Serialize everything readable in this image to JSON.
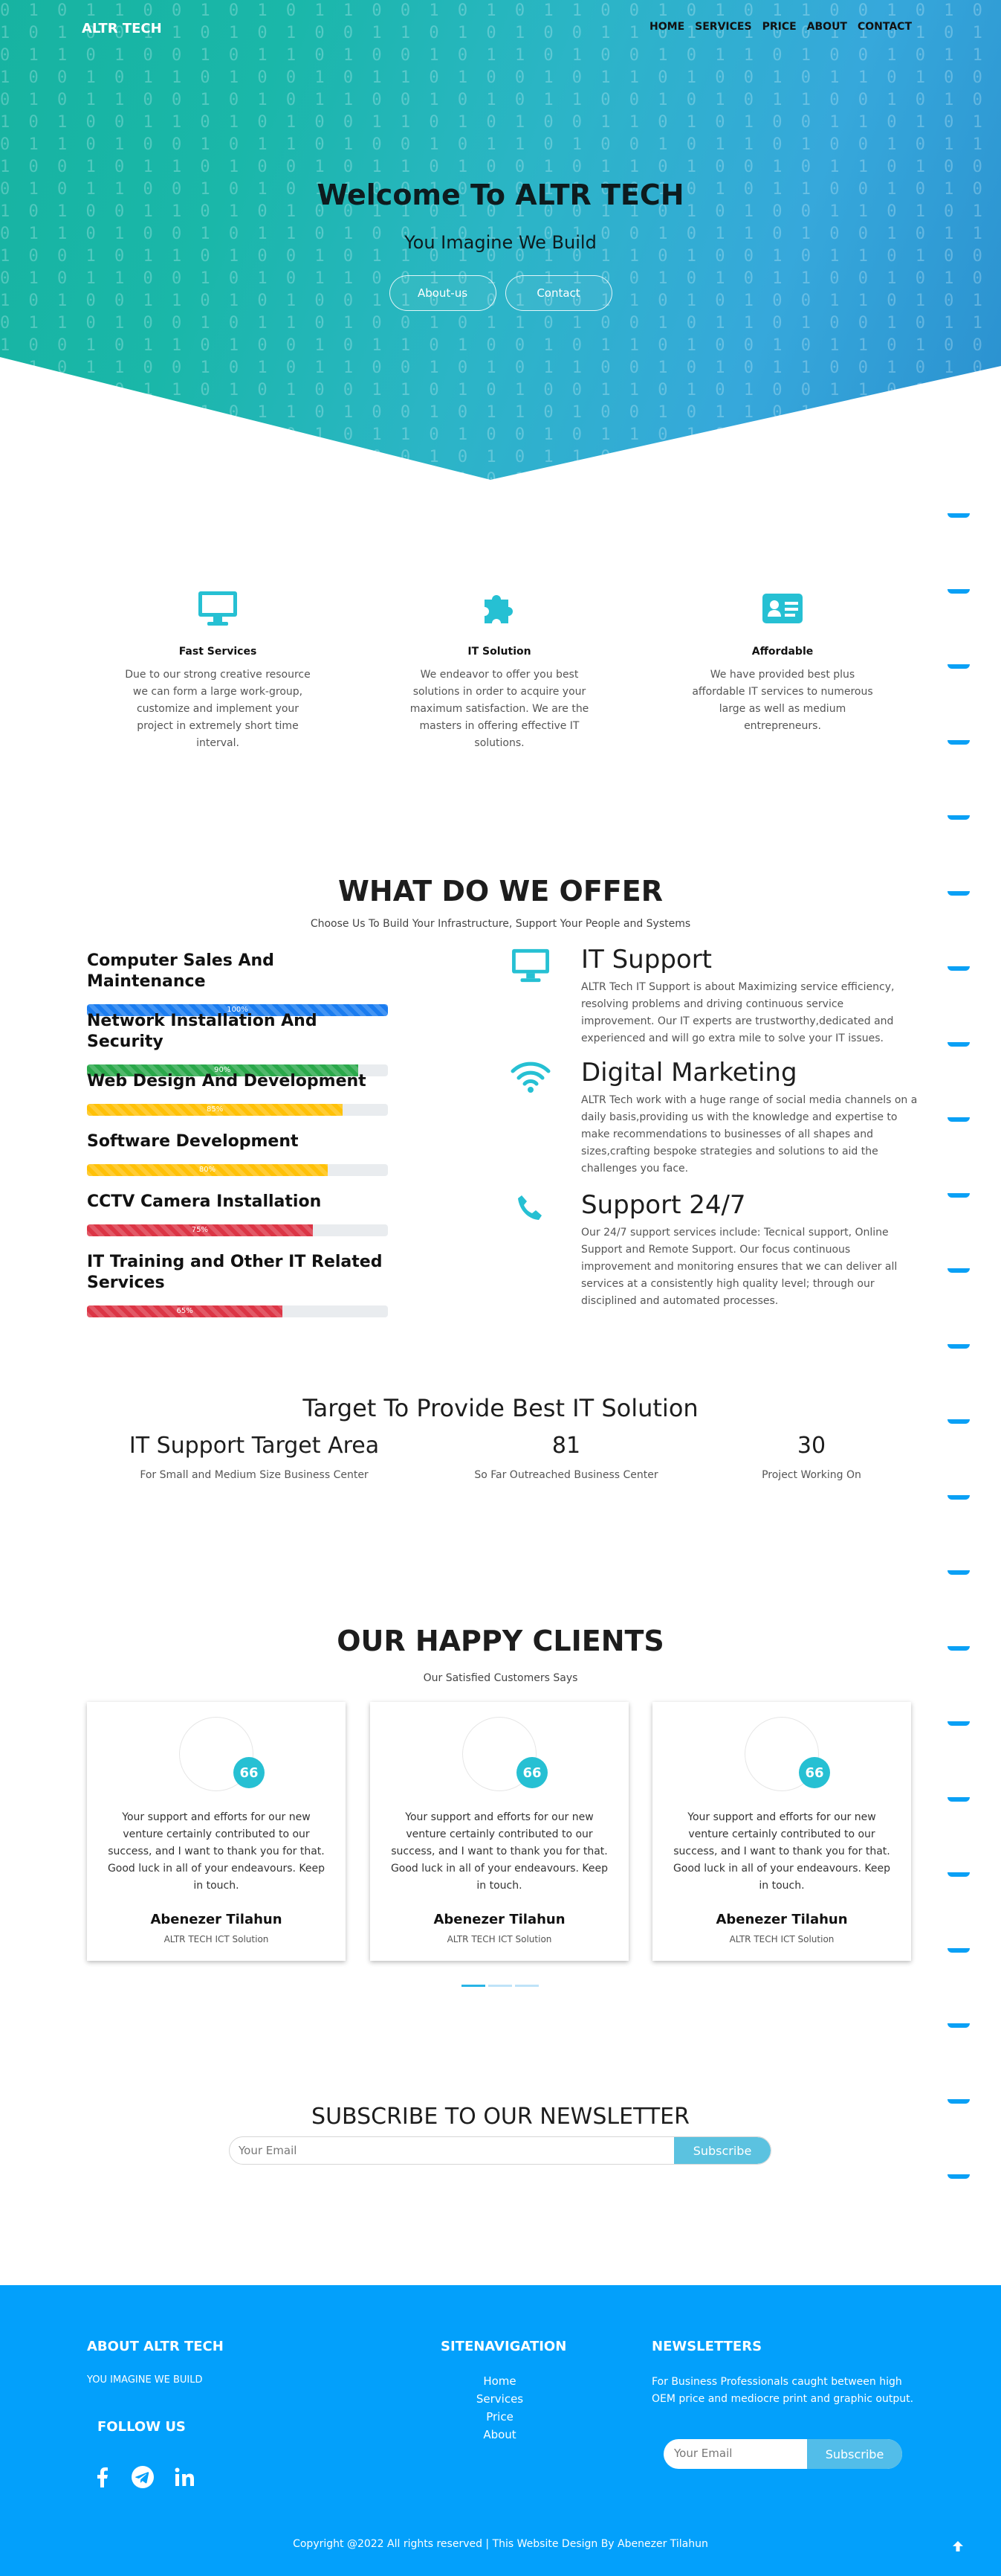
{
  "header": {
    "brand": "ALTR TECH",
    "nav": [
      "HOME",
      "SERVICES",
      "PRICE",
      "ABOUT",
      "CONTACT"
    ]
  },
  "hero": {
    "title": "Welcome To ALTR TECH",
    "subtitle": "You Imagine We Build",
    "buttons": [
      "About-us",
      "Contact"
    ]
  },
  "features": [
    {
      "icon": "monitor-icon",
      "title": "Fast  Services",
      "text": "Due to our strong creative resource we can form a large work-group, customize and implement your project in extremely short time interval."
    },
    {
      "icon": "puzzle-icon",
      "title": "IT Solution",
      "text": "We endeavor to offer you best solutions in order to acquire your maximum satisfaction. We are the masters in offering effective IT solutions."
    },
    {
      "icon": "id-card-icon",
      "title": "Affordable",
      "text": "We have provided best plus affordable IT services to numerous large as well as medium entrepreneurs."
    }
  ],
  "offer": {
    "title": "WHAT DO WE OFFER",
    "subtitle": "Choose Us To Build Your Infrastructure, Support Your People and Systems",
    "skills": [
      {
        "name": "Computer Sales And Maintenance",
        "percent": 100,
        "label": "100%",
        "color": "#1a7cf0"
      },
      {
        "name": "Network Installation And Security",
        "percent": 90,
        "label": "90%",
        "color": "#2aa84a"
      },
      {
        "name": "Web Design And Development",
        "percent": 85,
        "label": "85%",
        "color": "#ffc107"
      },
      {
        "name": "Software Development",
        "percent": 80,
        "label": "80%",
        "color": "#ffc107"
      },
      {
        "name": "CCTV Camera Installation",
        "percent": 75,
        "label": "75%",
        "color": "#dc3545"
      },
      {
        "name": "IT Training and Other IT Related Services",
        "percent": 65,
        "label": "65%",
        "color": "#dc3545"
      }
    ],
    "services": [
      {
        "icon": "monitor-icon",
        "title": "IT Support",
        "text": "ALTR Tech IT Support is about Maximizing service efficiency, resolving problems and driving continuous service improvement. Our IT experts are trustworthy,dedicated and experienced and will go extra mile to solve your IT issues."
      },
      {
        "icon": "wifi-icon",
        "title": "Digital Marketing",
        "text": "ALTR Tech work with a huge range of social media channels on a daily basis,providing us with the knowledge and expertise to make recommendations to businesses of all shapes and sizes,crafting bespoke strategies and solutions to aid the challenges you face."
      },
      {
        "icon": "phone-icon",
        "title": "Support 24/7",
        "text": "Our 24/7 support services include: Tecnical support, Online Support and Remote Support. Our focus continuous improvement and monitoring ensures that we can deliver all services at a consistently high quality level; through our disciplined and automated processes."
      }
    ]
  },
  "target": {
    "title": "Target To Provide Best IT Solution",
    "stats": [
      {
        "value": "IT Support Target Area",
        "label": "For Small and Medium Size Business Center"
      },
      {
        "value": "81",
        "label": "So Far Outreached Business Center"
      },
      {
        "value": "30",
        "label": "Project Working On"
      }
    ]
  },
  "clients": {
    "title": "OUR HAPPY CLIENTS",
    "subtitle": "Our Satisfied Customers Says",
    "badge": "66",
    "testimonials": [
      {
        "text": "Your support and efforts for our new venture certainly contributed to our success, and I want to thank you for that. Good luck in all of your endeavours. Keep in touch.",
        "name": "Abenezer Tilahun",
        "role": "ALTR TECH ICT Solution"
      },
      {
        "text": "Your support and efforts for our new venture certainly contributed to our success, and I want to thank you for that. Good luck in all of your endeavours. Keep in touch.",
        "name": "Abenezer Tilahun",
        "role": "ALTR TECH ICT Solution"
      },
      {
        "text": "Your support and efforts for our new venture certainly contributed to our success, and I want to thank you for that. Good luck in all of your endeavours. Keep in touch.",
        "name": "Abenezer Tilahun",
        "role": "ALTR TECH ICT Solution"
      }
    ]
  },
  "newsletter": {
    "title": "SUBSCRIBE TO OUR NEWSLETTER",
    "placeholder": "Your Email",
    "button": "Subscribe"
  },
  "footer": {
    "about_title": "ABOUT ALTR TECH",
    "about_text": "YOU IMAGINE WE BUILD",
    "follow_title": "FOLLOW US",
    "social": [
      "facebook-icon",
      "telegram-icon",
      "linkedin-icon"
    ],
    "sitenav_title": "SITENAVIGATION",
    "sitenav": [
      "Home",
      "Services",
      "Price",
      "About"
    ],
    "news_title": "NEWSLETTERS",
    "news_text": "For Business Professionals caught between high OEM price and mediocre print and graphic output.",
    "news_placeholder": "Your Email",
    "news_button": "Subscribe",
    "copyright": "Copyright @2022 All rights reserved | This Website Design By Abenezer Tilahun"
  },
  "colors": {
    "accent": "#26c0d3",
    "footer": "#03a0fb",
    "dash": "#0aa0f5"
  }
}
